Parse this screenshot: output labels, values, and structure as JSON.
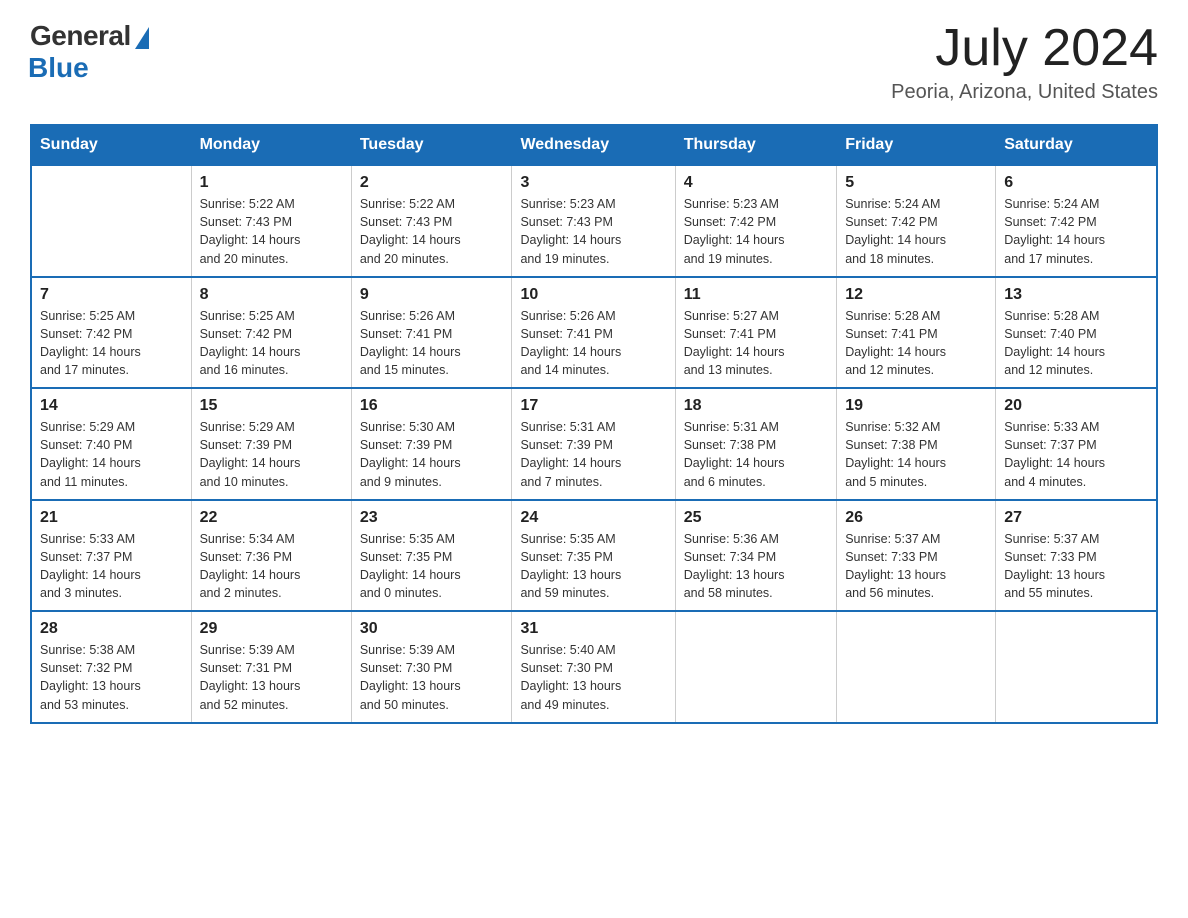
{
  "header": {
    "logo_general": "General",
    "logo_blue": "Blue",
    "month_year": "July 2024",
    "location": "Peoria, Arizona, United States"
  },
  "days_of_week": [
    "Sunday",
    "Monday",
    "Tuesday",
    "Wednesday",
    "Thursday",
    "Friday",
    "Saturday"
  ],
  "weeks": [
    [
      {
        "day": "",
        "info": ""
      },
      {
        "day": "1",
        "info": "Sunrise: 5:22 AM\nSunset: 7:43 PM\nDaylight: 14 hours\nand 20 minutes."
      },
      {
        "day": "2",
        "info": "Sunrise: 5:22 AM\nSunset: 7:43 PM\nDaylight: 14 hours\nand 20 minutes."
      },
      {
        "day": "3",
        "info": "Sunrise: 5:23 AM\nSunset: 7:43 PM\nDaylight: 14 hours\nand 19 minutes."
      },
      {
        "day": "4",
        "info": "Sunrise: 5:23 AM\nSunset: 7:42 PM\nDaylight: 14 hours\nand 19 minutes."
      },
      {
        "day": "5",
        "info": "Sunrise: 5:24 AM\nSunset: 7:42 PM\nDaylight: 14 hours\nand 18 minutes."
      },
      {
        "day": "6",
        "info": "Sunrise: 5:24 AM\nSunset: 7:42 PM\nDaylight: 14 hours\nand 17 minutes."
      }
    ],
    [
      {
        "day": "7",
        "info": "Sunrise: 5:25 AM\nSunset: 7:42 PM\nDaylight: 14 hours\nand 17 minutes."
      },
      {
        "day": "8",
        "info": "Sunrise: 5:25 AM\nSunset: 7:42 PM\nDaylight: 14 hours\nand 16 minutes."
      },
      {
        "day": "9",
        "info": "Sunrise: 5:26 AM\nSunset: 7:41 PM\nDaylight: 14 hours\nand 15 minutes."
      },
      {
        "day": "10",
        "info": "Sunrise: 5:26 AM\nSunset: 7:41 PM\nDaylight: 14 hours\nand 14 minutes."
      },
      {
        "day": "11",
        "info": "Sunrise: 5:27 AM\nSunset: 7:41 PM\nDaylight: 14 hours\nand 13 minutes."
      },
      {
        "day": "12",
        "info": "Sunrise: 5:28 AM\nSunset: 7:41 PM\nDaylight: 14 hours\nand 12 minutes."
      },
      {
        "day": "13",
        "info": "Sunrise: 5:28 AM\nSunset: 7:40 PM\nDaylight: 14 hours\nand 12 minutes."
      }
    ],
    [
      {
        "day": "14",
        "info": "Sunrise: 5:29 AM\nSunset: 7:40 PM\nDaylight: 14 hours\nand 11 minutes."
      },
      {
        "day": "15",
        "info": "Sunrise: 5:29 AM\nSunset: 7:39 PM\nDaylight: 14 hours\nand 10 minutes."
      },
      {
        "day": "16",
        "info": "Sunrise: 5:30 AM\nSunset: 7:39 PM\nDaylight: 14 hours\nand 9 minutes."
      },
      {
        "day": "17",
        "info": "Sunrise: 5:31 AM\nSunset: 7:39 PM\nDaylight: 14 hours\nand 7 minutes."
      },
      {
        "day": "18",
        "info": "Sunrise: 5:31 AM\nSunset: 7:38 PM\nDaylight: 14 hours\nand 6 minutes."
      },
      {
        "day": "19",
        "info": "Sunrise: 5:32 AM\nSunset: 7:38 PM\nDaylight: 14 hours\nand 5 minutes."
      },
      {
        "day": "20",
        "info": "Sunrise: 5:33 AM\nSunset: 7:37 PM\nDaylight: 14 hours\nand 4 minutes."
      }
    ],
    [
      {
        "day": "21",
        "info": "Sunrise: 5:33 AM\nSunset: 7:37 PM\nDaylight: 14 hours\nand 3 minutes."
      },
      {
        "day": "22",
        "info": "Sunrise: 5:34 AM\nSunset: 7:36 PM\nDaylight: 14 hours\nand 2 minutes."
      },
      {
        "day": "23",
        "info": "Sunrise: 5:35 AM\nSunset: 7:35 PM\nDaylight: 14 hours\nand 0 minutes."
      },
      {
        "day": "24",
        "info": "Sunrise: 5:35 AM\nSunset: 7:35 PM\nDaylight: 13 hours\nand 59 minutes."
      },
      {
        "day": "25",
        "info": "Sunrise: 5:36 AM\nSunset: 7:34 PM\nDaylight: 13 hours\nand 58 minutes."
      },
      {
        "day": "26",
        "info": "Sunrise: 5:37 AM\nSunset: 7:33 PM\nDaylight: 13 hours\nand 56 minutes."
      },
      {
        "day": "27",
        "info": "Sunrise: 5:37 AM\nSunset: 7:33 PM\nDaylight: 13 hours\nand 55 minutes."
      }
    ],
    [
      {
        "day": "28",
        "info": "Sunrise: 5:38 AM\nSunset: 7:32 PM\nDaylight: 13 hours\nand 53 minutes."
      },
      {
        "day": "29",
        "info": "Sunrise: 5:39 AM\nSunset: 7:31 PM\nDaylight: 13 hours\nand 52 minutes."
      },
      {
        "day": "30",
        "info": "Sunrise: 5:39 AM\nSunset: 7:30 PM\nDaylight: 13 hours\nand 50 minutes."
      },
      {
        "day": "31",
        "info": "Sunrise: 5:40 AM\nSunset: 7:30 PM\nDaylight: 13 hours\nand 49 minutes."
      },
      {
        "day": "",
        "info": ""
      },
      {
        "day": "",
        "info": ""
      },
      {
        "day": "",
        "info": ""
      }
    ]
  ]
}
